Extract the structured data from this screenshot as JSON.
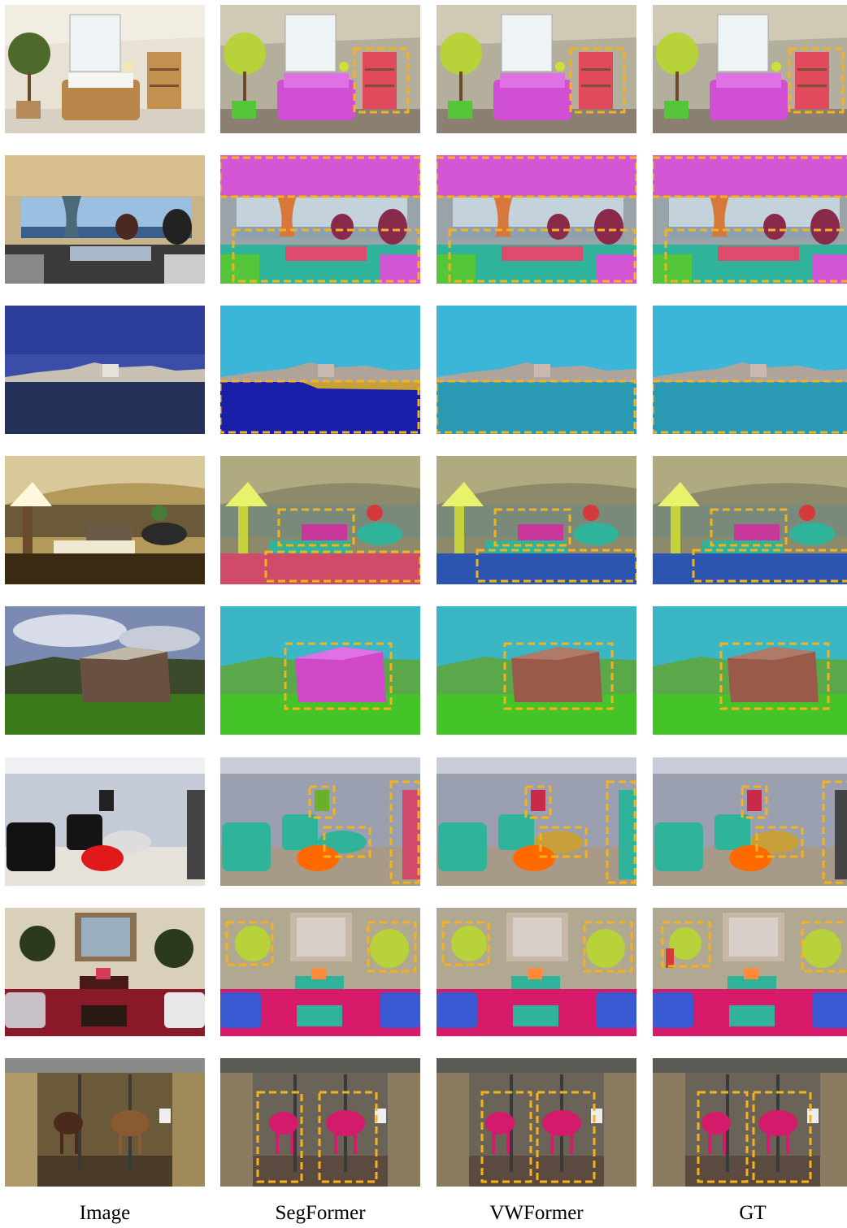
{
  "figure": {
    "columns": [
      "Image",
      "SegFormer",
      "VWFormer",
      "GT"
    ],
    "highlight_color": "#f5b21b",
    "rows": [
      {
        "scene": "bedroom"
      },
      {
        "scene": "rv-interior"
      },
      {
        "scene": "harbor"
      },
      {
        "scene": "lobby"
      },
      {
        "scene": "barn"
      },
      {
        "scene": "living-room-recliners"
      },
      {
        "scene": "living-room-mirror"
      },
      {
        "scene": "horse-stable"
      }
    ]
  }
}
